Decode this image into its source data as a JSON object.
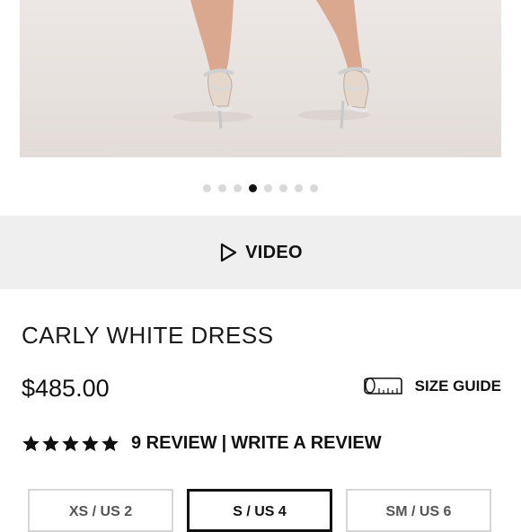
{
  "gallery": {
    "dots_count": 8,
    "active_dot": 3
  },
  "video": {
    "label": "VIDEO",
    "icon": "play-icon"
  },
  "product": {
    "title": "CARLY WHITE DRESS",
    "price": "$485.00"
  },
  "size_guide": {
    "label": "SIZE GUIDE",
    "icon": "measuring-tape-icon"
  },
  "reviews": {
    "rating": 5,
    "max_rating": 5,
    "count_label": "9 REVIEW",
    "separator": "|",
    "write_label": "WRITE A REVIEW"
  },
  "sizes": [
    {
      "label": "XS / US 2",
      "selected": false
    },
    {
      "label": "S / US 4",
      "selected": true
    },
    {
      "label": "SM / US 6",
      "selected": false
    }
  ]
}
